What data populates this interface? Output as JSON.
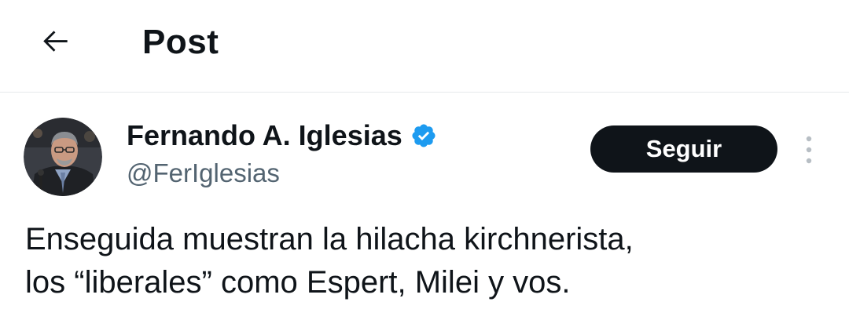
{
  "header": {
    "back_icon": "arrow-left-icon",
    "title": "Post"
  },
  "post": {
    "author": {
      "display_name": "Fernando A. Iglesias",
      "handle": "@FerIglesias",
      "verified_icon": "verified-badge-icon",
      "verified_color": "#1d9bf0"
    },
    "follow_label": "Seguir",
    "more_icon": "more-vertical-icon",
    "text_line_1": "Enseguida muestran la hilacha kirchnerista,",
    "text_line_2": "los “liberales” como Espert, Milei y vos."
  },
  "colors": {
    "text_primary": "#0f1419",
    "text_secondary": "#536471",
    "button_bg": "#0f1419",
    "divider": "#e6e9ec"
  }
}
